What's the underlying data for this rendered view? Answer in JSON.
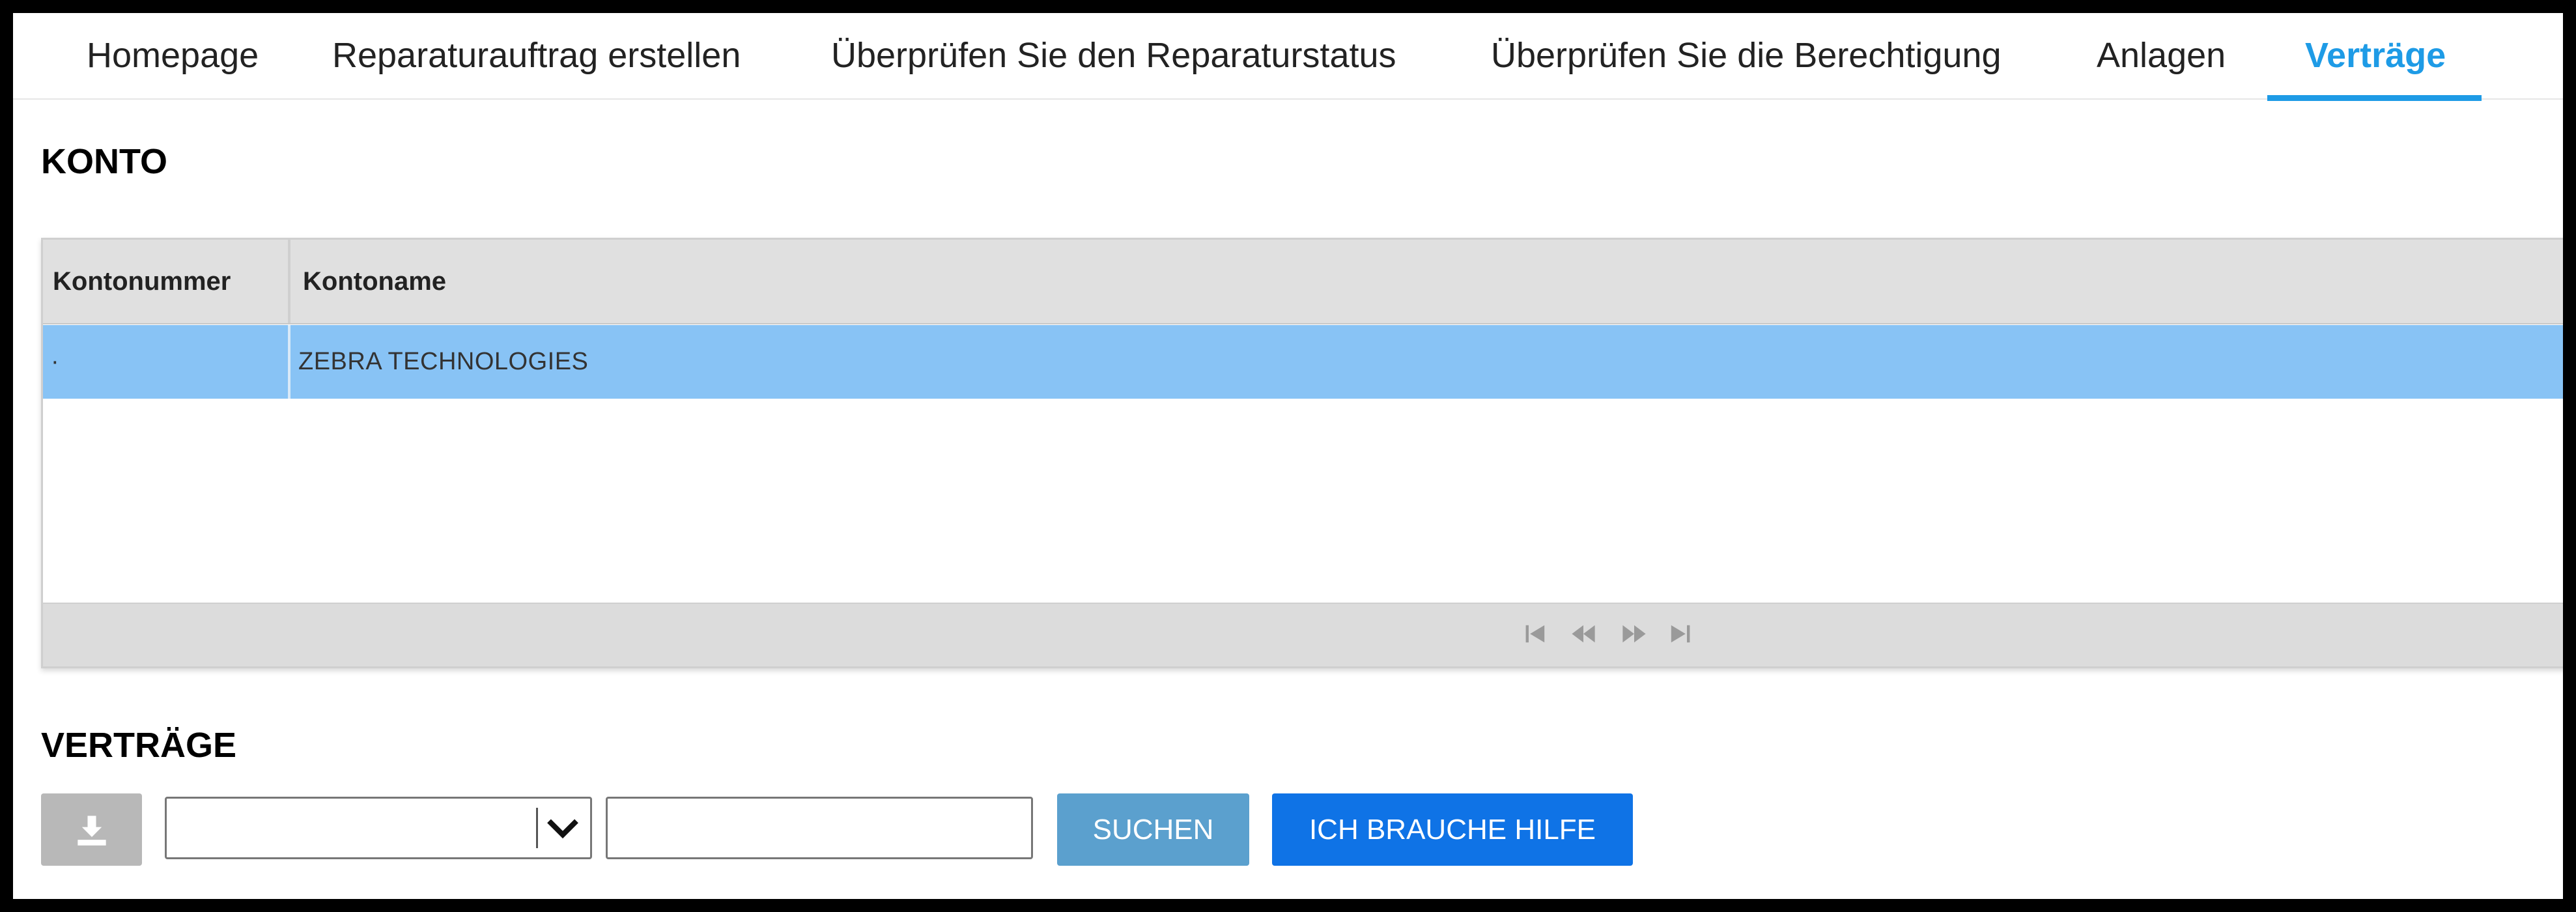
{
  "nav": {
    "tabs": [
      {
        "label": "Homepage",
        "active": false
      },
      {
        "label": "Reparaturauftrag erstellen",
        "active": false
      },
      {
        "label": "Überprüfen Sie den Reparaturstatus",
        "active": false
      },
      {
        "label": "Überprüfen Sie die Berechtigung",
        "active": false
      },
      {
        "label": "Anlagen",
        "active": false
      },
      {
        "label": "Verträge",
        "active": true
      }
    ]
  },
  "konto": {
    "title": "KONTO",
    "columns": [
      "Kontonummer",
      "Kontoname"
    ],
    "rows": [
      {
        "kontonummer": "·",
        "kontoname": "ZEBRA TECHNOLOGIES",
        "selected": true
      }
    ],
    "pager": [
      "first-page-icon",
      "previous-page-icon",
      "next-page-icon",
      "last-page-icon"
    ]
  },
  "vertraege": {
    "title": "VERTRÄGE",
    "download_icon": "download-icon",
    "select_value": "",
    "search_value": "",
    "search_label": "SUCHEN",
    "help_label": "ICH BRAUCHE HILFE"
  },
  "colors": {
    "accent": "#1e9be6",
    "row_selected": "#88c3f5",
    "search_button": "#5ba0ce",
    "help_button": "#0f73e6"
  }
}
